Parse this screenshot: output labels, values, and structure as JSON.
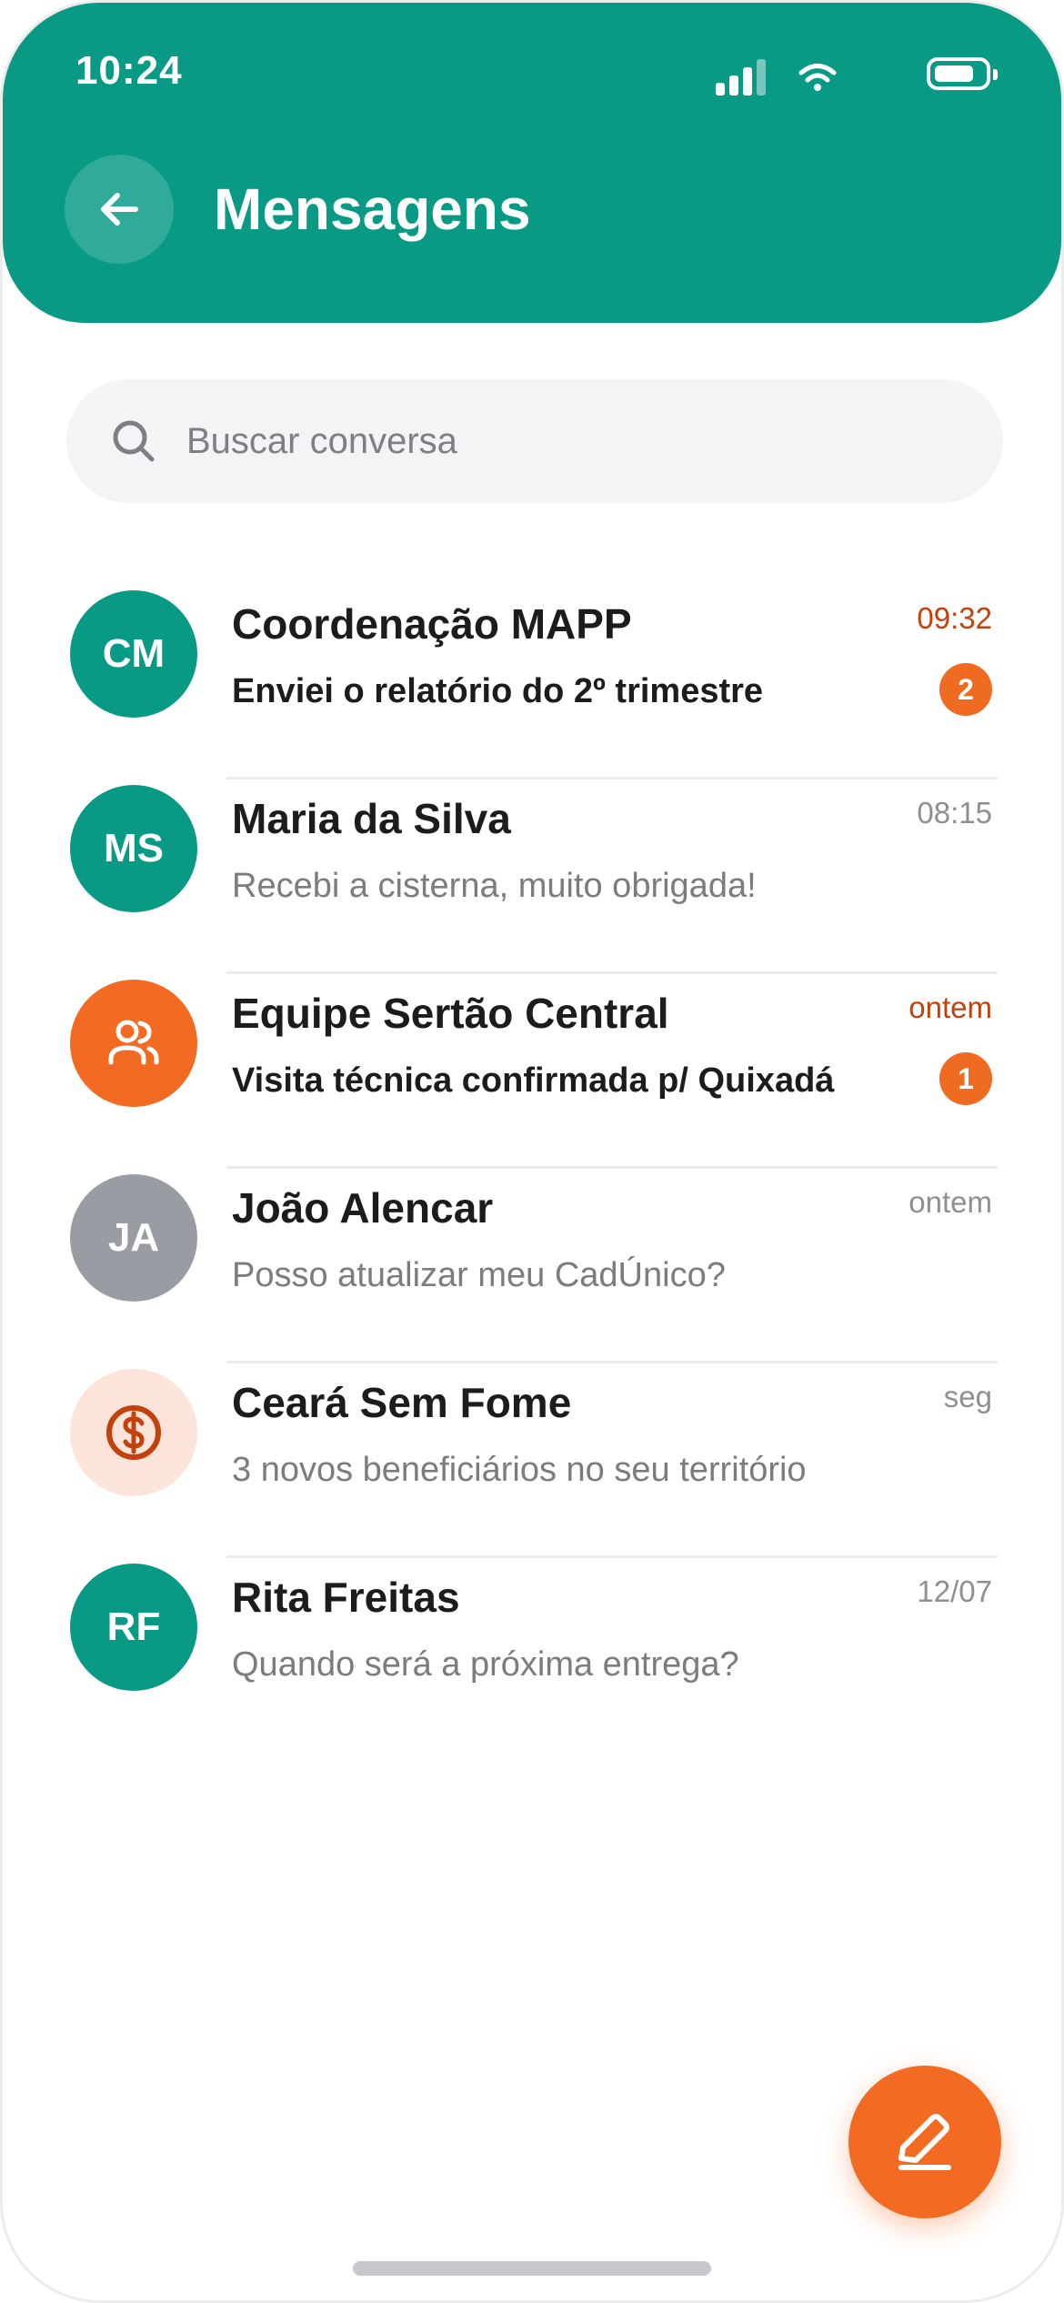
{
  "status_bar": {
    "time": "10:24"
  },
  "header": {
    "title": "Mensagens"
  },
  "search": {
    "placeholder": "Buscar conversa"
  },
  "colors": {
    "primary": "#099a86",
    "accent": "#f06b22",
    "unread_time": "#c2410c",
    "avatar_gray": "#9a9ca3",
    "avatar_light": "#fde4da"
  },
  "conversations": [
    {
      "initials": "CM",
      "name": "Coordenação MAPP",
      "preview": "Enviei o relatório do 2º trimestre",
      "time": "09:32",
      "badge": "2"
    },
    {
      "initials": "MS",
      "name": "Maria da Silva",
      "preview": "Recebi a cisterna, muito obrigada!",
      "time": "08:15"
    },
    {
      "icon": "group-icon",
      "name": "Equipe Sertão Central",
      "preview": "Visita técnica confirmada p/ Quixadá",
      "time": "ontem",
      "badge": "1"
    },
    {
      "initials": "JA",
      "name": "João Alencar",
      "preview": "Posso atualizar meu CadÚnico?",
      "time": "ontem"
    },
    {
      "icon": "dollar-icon",
      "name": "Ceará Sem Fome",
      "preview": "3 novos beneficiários no seu território",
      "time": "seg"
    },
    {
      "initials": "RF",
      "name": "Rita Freitas",
      "preview": "Quando será a próxima entrega?",
      "time": "12/07"
    }
  ],
  "fab": {
    "icon": "pencil-icon"
  }
}
